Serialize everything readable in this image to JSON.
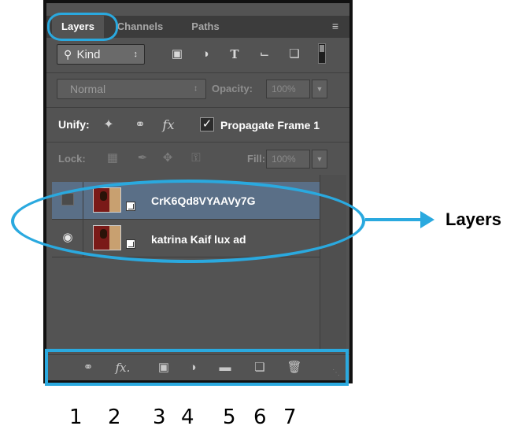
{
  "tabs": [
    {
      "label": "Layers",
      "active": true
    },
    {
      "label": "Channels",
      "active": false
    },
    {
      "label": "Paths",
      "active": false
    }
  ],
  "panel_menu_icon": "≡",
  "filter": {
    "kind_label": "Kind",
    "icons": [
      "image-filter-icon",
      "adjustment-filter-icon",
      "type-filter-icon",
      "shape-filter-icon",
      "smart-object-filter-icon"
    ]
  },
  "blend_mode": "Normal",
  "opacity": {
    "label": "Opacity:",
    "value": "100%"
  },
  "unify": {
    "label": "Unify:",
    "icons": [
      "unify-position-icon",
      "unify-visibility-icon",
      "unify-style-icon"
    ],
    "propagate_label": "Propagate Frame 1",
    "propagate_checked": true
  },
  "lock": {
    "label": "Lock:"
  },
  "fill": {
    "label": "Fill:",
    "value": "100%"
  },
  "layers": [
    {
      "name": "CrK6Qd8VYAAVy7G",
      "visible": false,
      "selected": true
    },
    {
      "name": "katrina Kaif lux ad",
      "visible": true,
      "selected": false
    }
  ],
  "bottom_icons": [
    "link-layers-icon",
    "fx-icon",
    "mask-icon",
    "adjustment-layer-icon",
    "group-folder-icon",
    "new-layer-icon",
    "trash-icon"
  ],
  "annotation": {
    "label": "Layers",
    "numbers": [
      "1",
      "2",
      "3",
      "4",
      "5",
      "6",
      "7"
    ],
    "color": "#2aa9df"
  },
  "colors": {
    "panel": "#535353",
    "selected_row": "#5a6f87",
    "annotation": "#2aa9df"
  }
}
